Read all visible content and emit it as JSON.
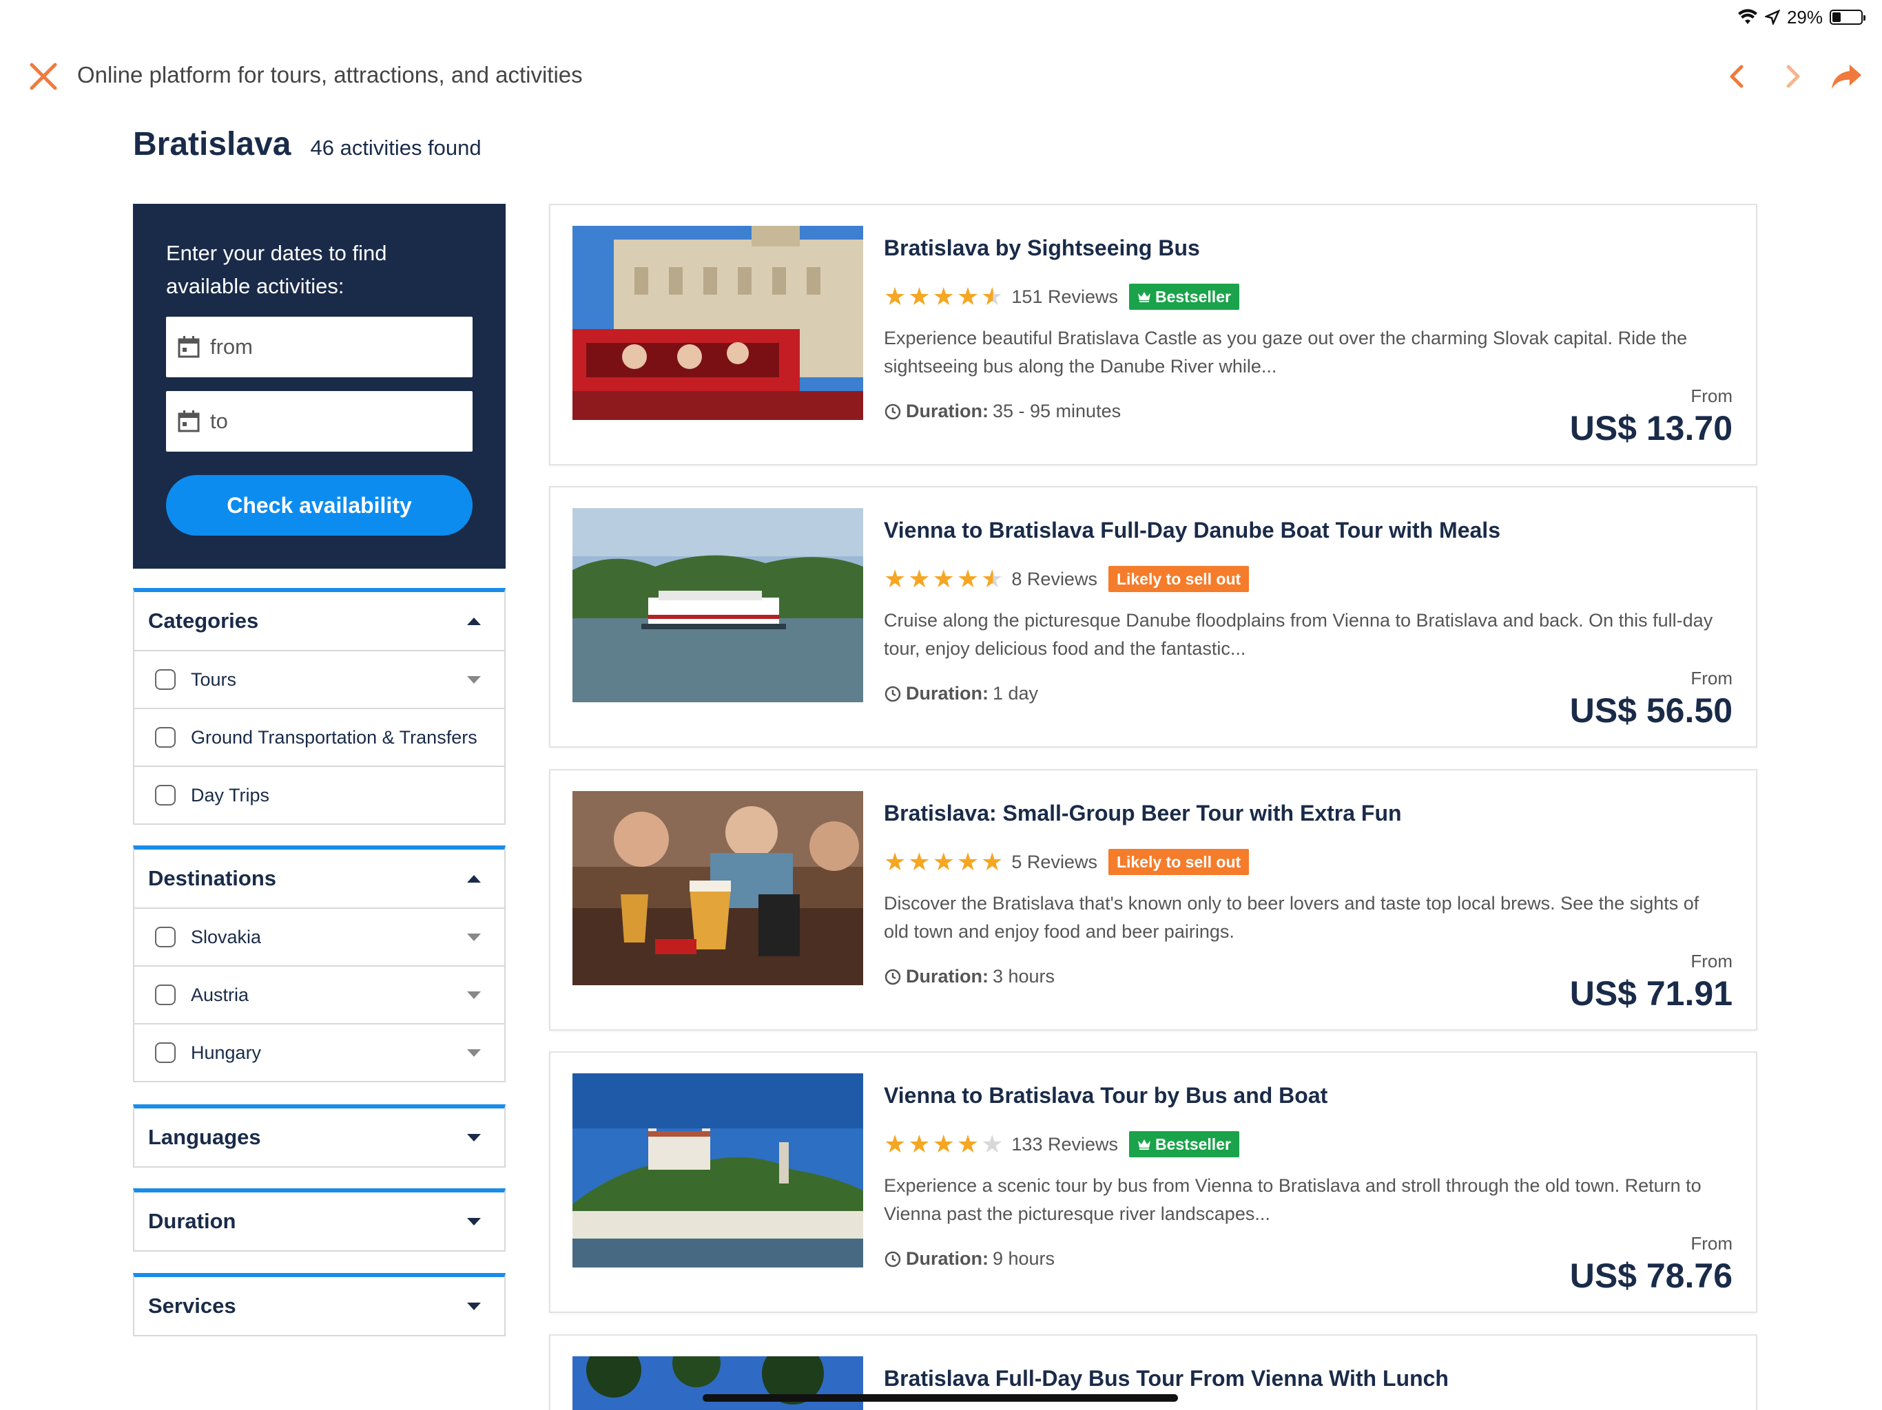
{
  "status": {
    "battery": "29%",
    "battery_level": 0.29
  },
  "topbar": {
    "title": "Online platform for tours, attractions, and activities"
  },
  "heading": {
    "city": "Bratislava",
    "count": "46 activities found"
  },
  "dates": {
    "title": "Enter your dates to find available activities:",
    "from_placeholder": "from",
    "to_placeholder": "to",
    "button": "Check availability"
  },
  "filters": {
    "categories": {
      "label": "Categories",
      "items": [
        "Tours",
        "Ground Transportation & Transfers",
        "Day Trips"
      ]
    },
    "destinations": {
      "label": "Destinations",
      "items": [
        "Slovakia",
        "Austria",
        "Hungary"
      ]
    },
    "languages": {
      "label": "Languages"
    },
    "duration": {
      "label": "Duration"
    },
    "services": {
      "label": "Services"
    }
  },
  "activities": [
    {
      "title": "Bratislava by Sightseeing Bus",
      "rating": 4.5,
      "reviews": "151 Reviews",
      "badge": "Bestseller",
      "badge_color": "#1aa34a",
      "description": "Experience beautiful Bratislava Castle as you gaze out over the charming Slovak capital. Ride the sightseeing bus along the Danube River while...",
      "duration_label": "Duration:",
      "duration": "35 - 95 minutes",
      "from_label": "From",
      "price": "US$ 13.70"
    },
    {
      "title": "Vienna to Bratislava Full-Day Danube Boat Tour with Meals",
      "rating": 4.5,
      "reviews": "8 Reviews",
      "badge": "Likely to sell out",
      "badge_color": "#f57c2b",
      "description": "Cruise along the picturesque Danube floodplains from Vienna to Bratislava and back. On this full-day tour, enjoy delicious food and the fantastic...",
      "duration_label": "Duration:",
      "duration": "1 day",
      "from_label": "From",
      "price": "US$ 56.50"
    },
    {
      "title": "Bratislava: Small-Group Beer Tour with Extra Fun",
      "rating": 5,
      "reviews": "5 Reviews",
      "badge": "Likely to sell out",
      "badge_color": "#f57c2b",
      "description": "Discover the Bratislava that's known only to beer lovers and taste top local brews. See the sights of old town and enjoy food and beer pairings.",
      "duration_label": "Duration:",
      "duration": "3 hours",
      "from_label": "From",
      "price": "US$ 71.91"
    },
    {
      "title": "Vienna to Bratislava Tour by Bus and Boat",
      "rating": 4,
      "reviews": "133 Reviews",
      "badge": "Bestseller",
      "badge_color": "#1aa34a",
      "description": "Experience a scenic tour by bus from Vienna to Bratislava and stroll through the old town. Return to Vienna past the picturesque river landscapes...",
      "duration_label": "Duration:",
      "duration": "9 hours",
      "from_label": "From",
      "price": "US$ 78.76"
    },
    {
      "title": "Bratislava Full-Day Bus Tour From Vienna With Lunch"
    }
  ],
  "colors": {
    "accent": "#f07a3c",
    "navy": "#1a2b49",
    "primary": "#0d8cf0"
  }
}
